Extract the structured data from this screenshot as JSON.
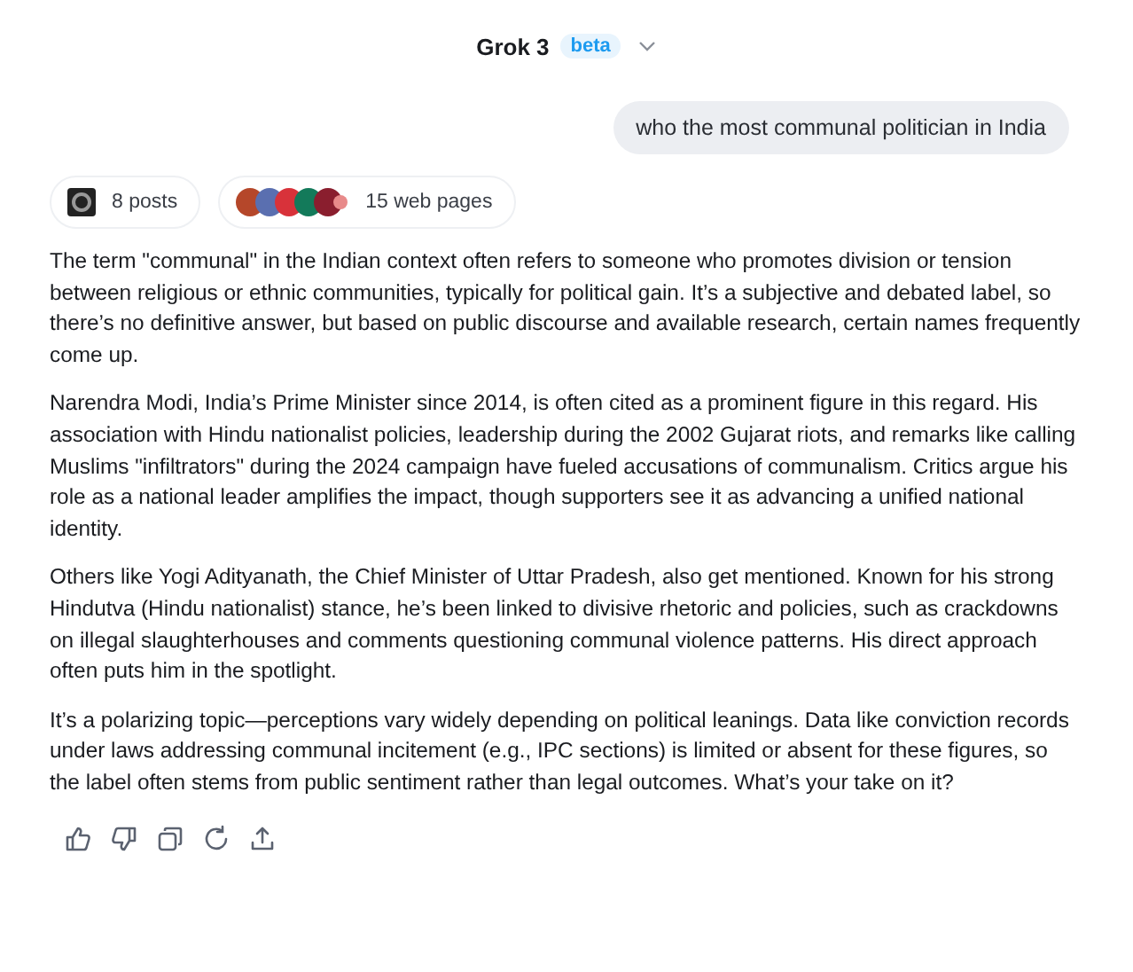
{
  "header": {
    "title": "Grok 3",
    "badge": "beta"
  },
  "user_message": "who the most communal politician in India",
  "sources": [
    {
      "kind": "posts",
      "label": "8 posts"
    },
    {
      "kind": "web",
      "label": "15 web pages"
    }
  ],
  "answer": [
    "The term \"communal\" in the Indian context often refers to someone who promotes division or tension between religious or ethnic communities, typically for political gain. It’s a subjective and debated label, so there’s no definitive answer, but based on public discourse and available research, certain names frequently come up.",
    "Narendra Modi, India’s Prime Minister since 2014, is often cited as a prominent figure in this regard. His association with Hindu nationalist policies, leadership during the 2002 Gujarat riots, and remarks like calling Muslims \"infiltrators\" during the 2024 campaign have fueled accusations of communalism. Critics argue his role as a national leader amplifies the impact, though supporters see it as advancing a unified national identity.",
    "Others like Yogi Adityanath, the Chief Minister of Uttar Pradesh, also get mentioned. Known for his strong Hindutva (Hindu nationalist) stance, he’s been linked to divisive rhetoric and policies, such as crackdowns on illegal slaughterhouses and comments questioning communal violence patterns. His direct approach often puts him in the spotlight.",
    "It’s a polarizing topic—perceptions vary widely depending on political leanings. Data like conviction records under laws addressing communal incitement (e.g., IPC sections) is limited or absent for these figures, so the label often stems from public sentiment rather than legal outcomes. What’s your take on it?"
  ],
  "actions": [
    {
      "kind": "like"
    },
    {
      "kind": "dislike"
    },
    {
      "kind": "copy"
    },
    {
      "kind": "regenerate"
    },
    {
      "kind": "share"
    }
  ]
}
